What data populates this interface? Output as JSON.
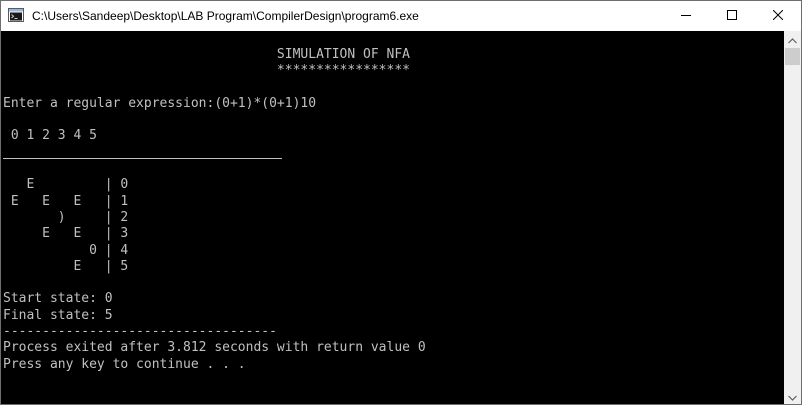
{
  "window": {
    "title": "C:\\Users\\Sandeep\\Desktop\\LAB Program\\CompilerDesign\\program6.exe",
    "icon": "console-app-icon",
    "buttons": {
      "minimize": "minimize-icon",
      "maximize": "maximize-icon",
      "close": "close-icon"
    }
  },
  "console": {
    "lines": [
      "                                   SIMULATION OF NFA",
      "                                   *****************",
      "",
      "Enter a regular expression:(0+1)*(0+1)10",
      "",
      " 0 1 2 3 4 5",
      "",
      "",
      "   E         | 0",
      " E   E   E   | 1",
      "       )     | 2",
      "     E   E   | 3",
      "           0 | 4",
      "         E   | 5",
      "",
      "Start state: 0",
      "Final state: 5",
      "-----------------------------------",
      "Process exited after 3.812 seconds with return value 0",
      "Press any key to continue . . ."
    ]
  },
  "colors": {
    "console_bg": "#000000",
    "console_fg": "#c0c0c0",
    "titlebar_bg": "#ffffff",
    "scrollbar_bg": "#f0f0f0"
  }
}
